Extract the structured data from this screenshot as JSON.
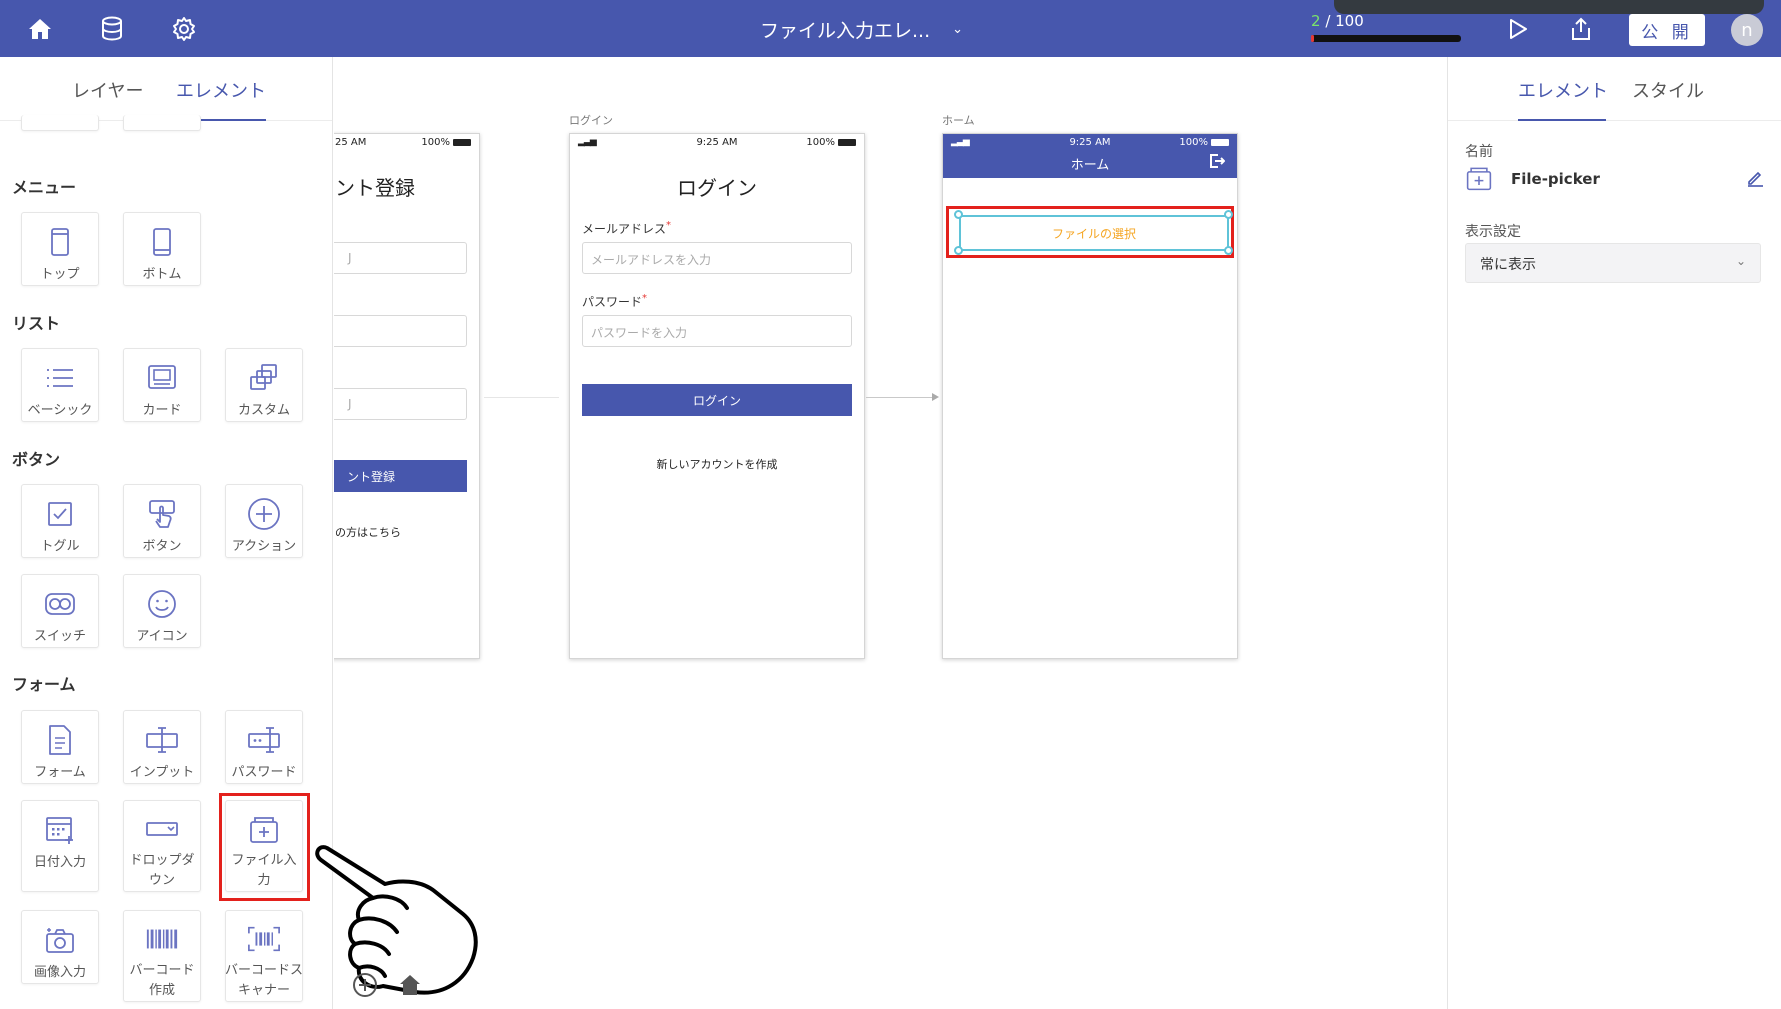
{
  "topbar": {
    "title": "ファイル入力エレ...",
    "counter_current": "2",
    "counter_rest": " / 100",
    "progress": 0.02,
    "publish_label": "公 開",
    "avatar_initial": "n",
    "icons": [
      "home-icon",
      "database-icon",
      "gear-icon",
      "play-icon",
      "upload-icon"
    ],
    "accent": "#4757ad"
  },
  "left_panel": {
    "tabs": [
      "レイヤー",
      "エレメント"
    ],
    "active_tab": "エレメント",
    "sections": {
      "menu": {
        "title": "メニュー",
        "items": [
          "トップ",
          "ボトム"
        ]
      },
      "list": {
        "title": "リスト",
        "items": [
          "ベーシック",
          "カード",
          "カスタム"
        ]
      },
      "button": {
        "title": "ボタン",
        "items": [
          "トグル",
          "ボタン",
          "アクション",
          "スイッチ",
          "アイコン"
        ]
      },
      "form": {
        "title": "フォーム",
        "items": [
          "フォーム",
          "インプット",
          "パスワード",
          "日付入力",
          "ドロップダウン",
          "ファイル入力",
          "画像入力",
          "バーコード作成",
          "バーコードスキャナー"
        ]
      }
    },
    "highlighted_item": "ファイル入力"
  },
  "canvas": {
    "register_screen": {
      "status_time": "25 AM",
      "status_battery": "100%",
      "heading": "ント登録",
      "button_label": "ント登録",
      "link_text": "の方はこちら",
      "input_hint_1": "J",
      "input_hint_2": "J"
    },
    "login_screen": {
      "label": "ログイン",
      "status_time": "9:25 AM",
      "status_battery": "100%",
      "heading": "ログイン",
      "email_label": "メールアドレス",
      "email_placeholder": "メールアドレスを入力",
      "password_label": "パスワード",
      "password_placeholder": "パスワードを入力",
      "login_button": "ログイン",
      "create_account": "新しいアカウントを作成",
      "required_mark": "*"
    },
    "home_screen": {
      "label": "ホーム",
      "status_time": "9:25 AM",
      "status_battery": "100%",
      "header_title": "ホーム",
      "file_button": "ファイルの選択"
    }
  },
  "right_panel": {
    "tabs": [
      "エレメント",
      "スタイル"
    ],
    "active_tab": "エレメント",
    "name_label": "名前",
    "name_value": "File-picker",
    "visibility_label": "表示設定",
    "visibility_value": "常に表示"
  }
}
